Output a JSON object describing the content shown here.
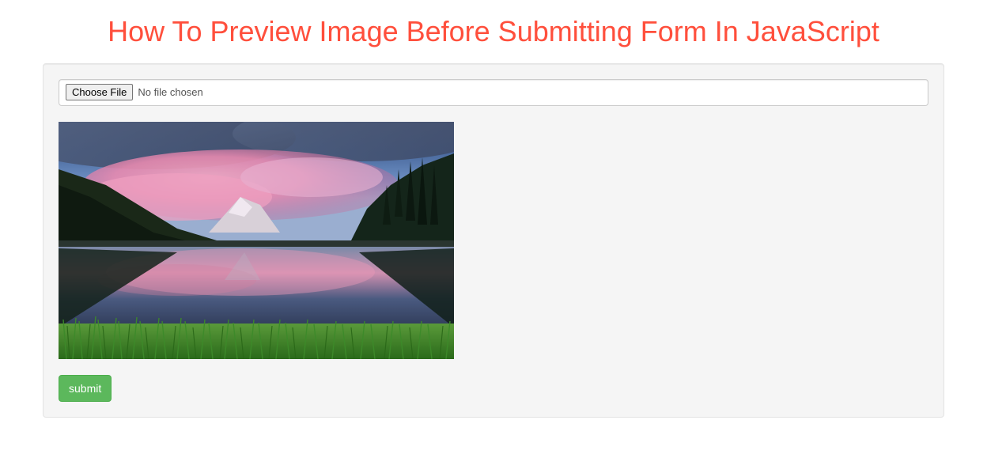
{
  "heading": "How To Preview Image Before Submitting Form In JavaScript",
  "file": {
    "choose_label": "Choose File",
    "status_text": "No file chosen"
  },
  "submit_label": "submit",
  "colors": {
    "danger": "#FF4F3C",
    "success": "#5cb85c"
  }
}
